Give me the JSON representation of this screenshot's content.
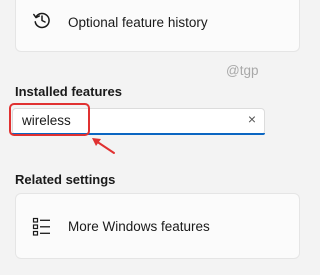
{
  "history": {
    "label": "Optional feature history",
    "icon": "history-icon"
  },
  "watermark": "@tgp",
  "installed": {
    "title": "Installed features",
    "search_value": "wireless",
    "clear_icon": "×"
  },
  "related": {
    "title": "Related settings",
    "more_label": "More Windows features",
    "more_icon": "list-icon"
  },
  "colors": {
    "accent": "#0b66c2",
    "highlight": "#e03131"
  }
}
